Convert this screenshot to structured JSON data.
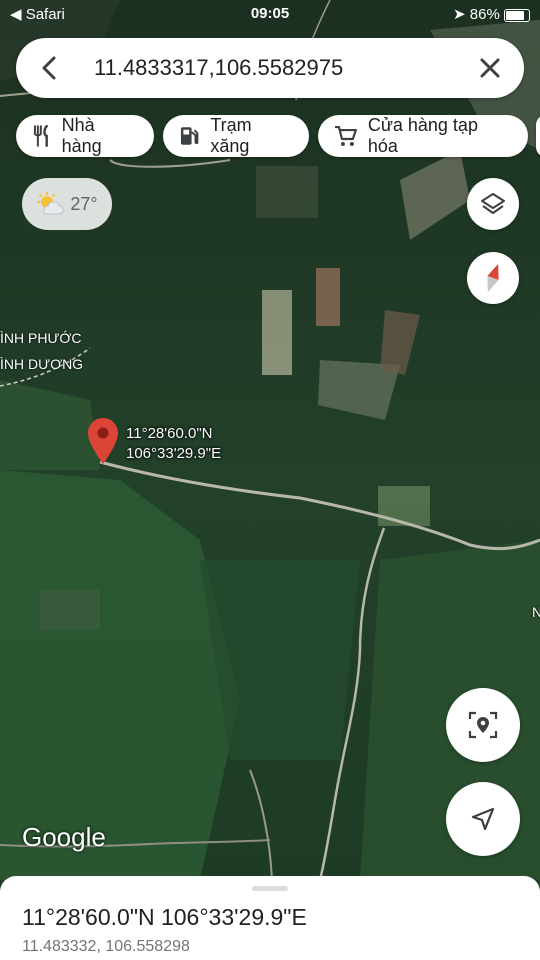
{
  "status_bar": {
    "back_app": "◀ Safari",
    "time": "09:05",
    "battery": "86%"
  },
  "search": {
    "query": "11.4833317,106.5582975"
  },
  "chips": [
    {
      "label": "Nhà hàng",
      "icon": "restaurant-icon"
    },
    {
      "label": "Trạm xăng",
      "icon": "gas-station-icon"
    },
    {
      "label": "Cửa hàng tạp hóa",
      "icon": "shopping-cart-icon"
    }
  ],
  "weather": {
    "temperature": "27°",
    "icon": "partly-cloudy-icon"
  },
  "map": {
    "region_labels": [
      "ÌNH PHƯỚC",
      "ÌNH DƯƠNG"
    ],
    "edge_label": "N",
    "pin_label_line1": "11°28'60.0\"N",
    "pin_label_line2": "106°33'29.9\"E",
    "attribution": "Google"
  },
  "place_sheet": {
    "title": "11°28'60.0\"N 106°33'29.9\"E",
    "decimal": "11.483332, 106.558298"
  },
  "colors": {
    "pin": "#db4437",
    "forest_dark": "#1e3524",
    "forest_light": "#2f5a34"
  }
}
